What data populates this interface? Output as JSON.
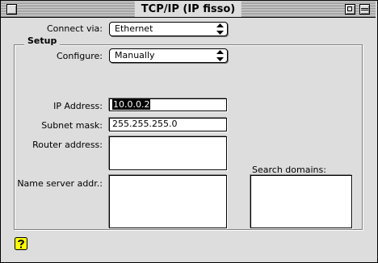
{
  "window": {
    "title": "TCP/IP (IP fisso)"
  },
  "connect": {
    "label": "Connect via:",
    "value": "Ethernet"
  },
  "setup": {
    "title": "Setup",
    "configure": {
      "label": "Configure:",
      "value": "Manually"
    },
    "ip_address": {
      "label": "IP Address:",
      "value": "10.0.0.2"
    },
    "subnet_mask": {
      "label": "Subnet mask:",
      "value": "255.255.255.0"
    },
    "router_address": {
      "label": "Router address:",
      "value": ""
    },
    "name_server": {
      "label": "Name server addr.:",
      "value": ""
    },
    "search_domains": {
      "label": "Search domains:",
      "value": ""
    }
  },
  "icons": {
    "close": "close-box-icon",
    "zoom": "zoom-box-icon",
    "collapse": "collapse-box-icon",
    "help": "help-icon"
  },
  "colors": {
    "window_bg": "#dddddd",
    "selection_bg": "#000000",
    "help_yellow": "#ffff00"
  }
}
